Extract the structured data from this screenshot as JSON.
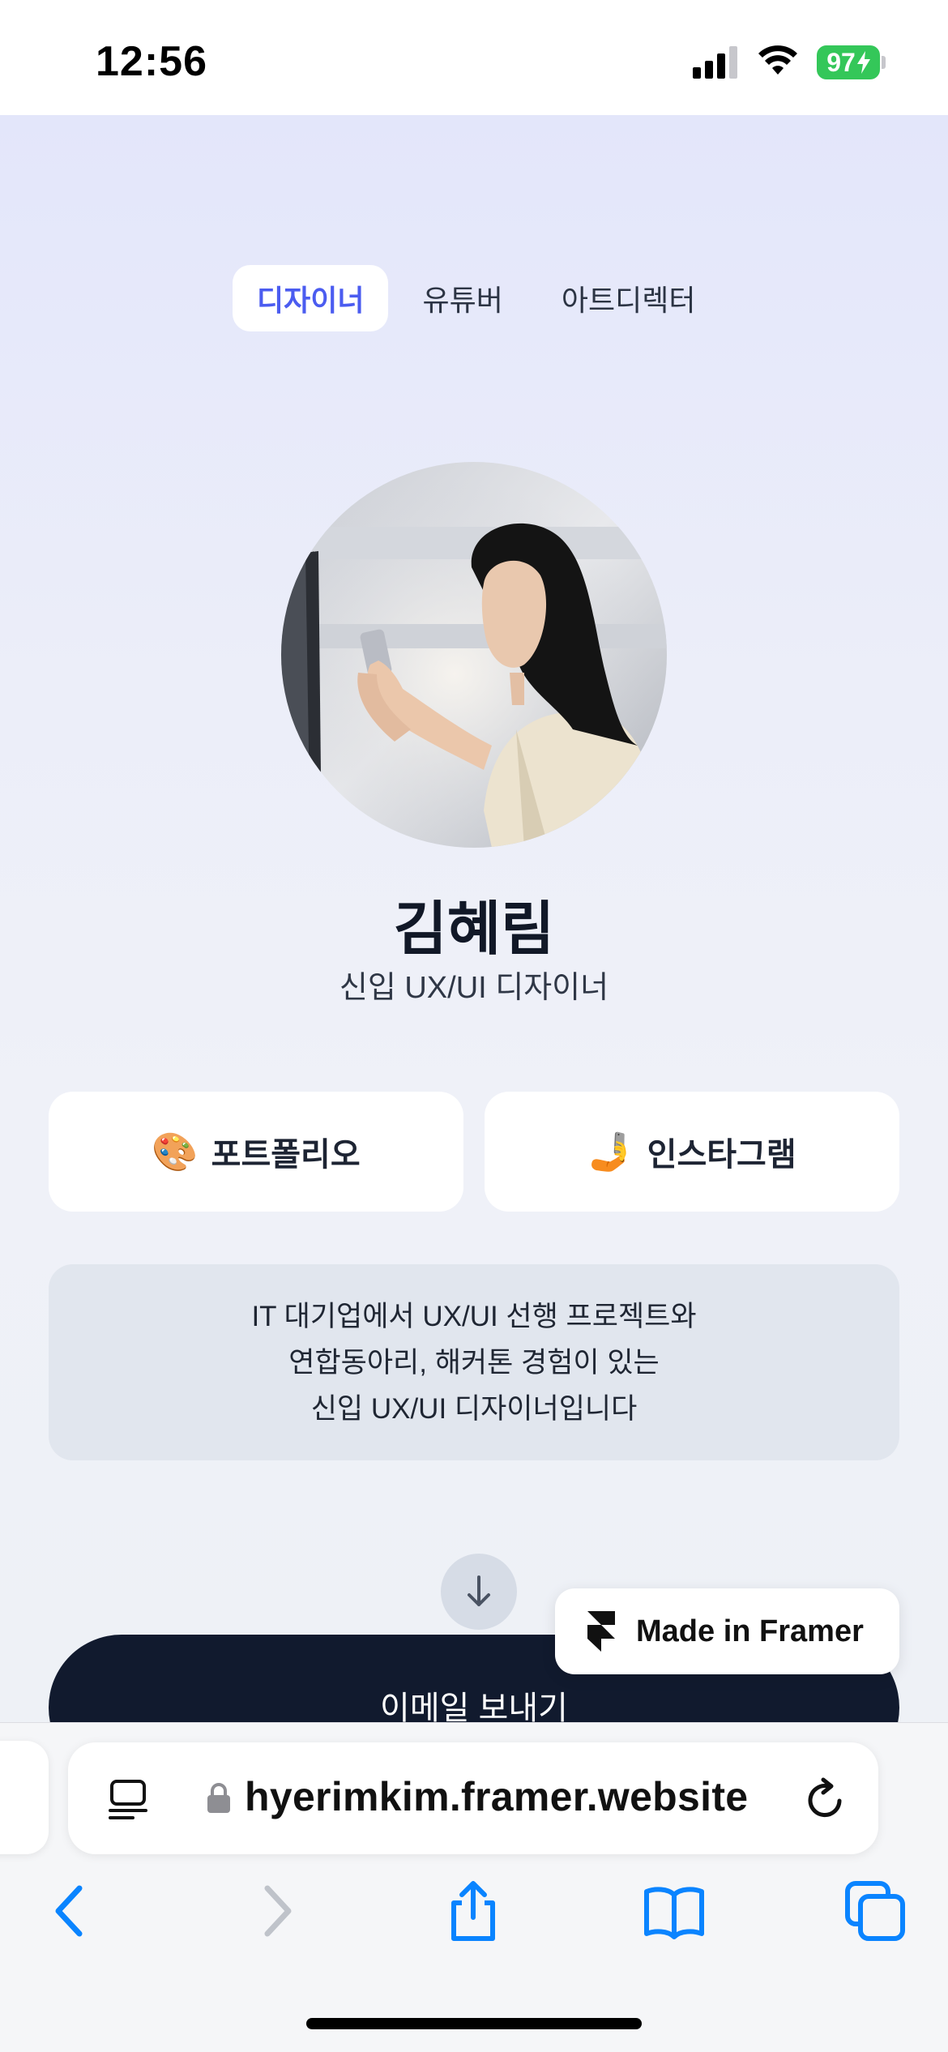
{
  "status_bar": {
    "time": "12:56",
    "battery": "97"
  },
  "tabs": [
    {
      "label": "디자이너",
      "active": true
    },
    {
      "label": "유튜버",
      "active": false
    },
    {
      "label": "아트디렉터",
      "active": false
    }
  ],
  "profile": {
    "name": "김혜림",
    "subtitle": "신입 UX/UI 디자이너"
  },
  "links": [
    {
      "emoji": "🎨",
      "label": "포트폴리오"
    },
    {
      "emoji": "🤳",
      "label": "인스타그램"
    }
  ],
  "intro": {
    "lines": [
      "IT 대기업에서 UX/UI 선행 프로젝트와",
      "연합동아리, 해커톤 경험이 있는",
      "신입 UX/UI 디자이너입니다"
    ]
  },
  "email_button": "이메일 보내기",
  "framer_badge": "Made in Framer",
  "browser": {
    "url": "hyerimkim.framer.website"
  },
  "colors": {
    "accent": "#4b5cf0",
    "dark_button": "#111a2e",
    "battery_green": "#34c759",
    "ios_blue": "#0a84ff"
  }
}
